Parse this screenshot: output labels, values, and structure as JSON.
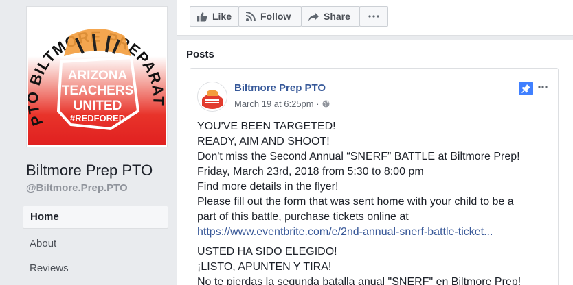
{
  "page": {
    "name": "Biltmore Prep PTO",
    "handle": "@Biltmore.Prep.PTO",
    "logo_text": {
      "arc": "PTO BILTMORE PREPARATORY",
      "line1": "ARIZONA",
      "line2": "TEACHERS",
      "line3": "UNITED",
      "hashtag": "#REDFORED"
    }
  },
  "nav": {
    "items": [
      {
        "label": "Home"
      },
      {
        "label": "About"
      },
      {
        "label": "Reviews"
      }
    ]
  },
  "actions": {
    "like": "Like",
    "follow": "Follow",
    "share": "Share"
  },
  "posts": {
    "title": "Posts",
    "post": {
      "author": "Biltmore Prep PTO",
      "timestamp": "March 19 at 6:25pm ·",
      "lines_en": [
        "YOU'VE BEEN TARGETED!",
        "READY, AIM AND SHOOT!",
        "Don't miss the Second Annual “SNERF” BATTLE at Biltmore Prep!",
        "Friday, March 23rd, 2018 from 5:30 to 8:00 pm",
        "Find more details in the flyer!",
        "Please fill out the form that was sent home with your child to be a",
        "part of this battle, purchase tickets online at"
      ],
      "link": "https://www.eventbrite.com/e/2nd-annual-snerf-battle-ticket...",
      "lines_es": [
        "USTED HA SIDO ELEGIDO!",
        "¡LISTO, APUNTEN Y TIRA!",
        "No te pierdas la segunda batalla anual \"SNERF\" en Biltmore Prep!"
      ]
    }
  },
  "colors": {
    "link": "#385898",
    "author": "#365899",
    "pin": "#4080ff",
    "brand_red": "#e02020"
  }
}
